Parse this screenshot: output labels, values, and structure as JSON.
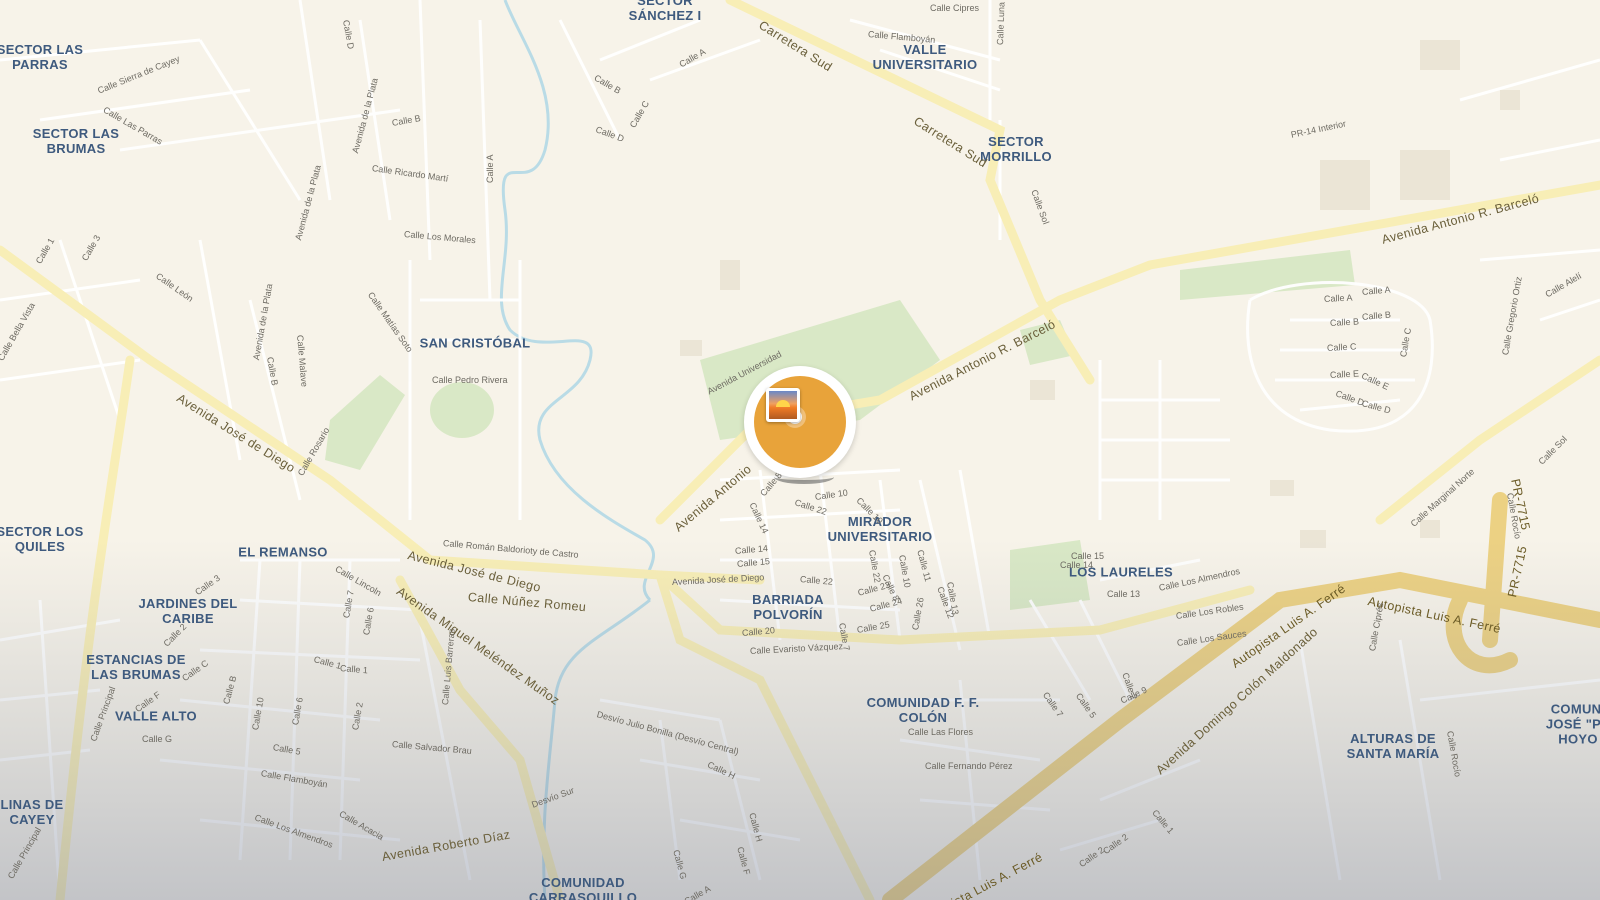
{
  "map": {
    "areas": [
      {
        "id": "sector-sanchez",
        "text": "SECTOR\nSÁNCHEZ I"
      },
      {
        "id": "valle-universitario",
        "text": "VALLE\nUNIVERSITARIO"
      },
      {
        "id": "sector-las-parras",
        "text": "SECTOR LAS\nPARRAS"
      },
      {
        "id": "sector-las-brumas",
        "text": "SECTOR LAS\nBRUMAS"
      },
      {
        "id": "sector-morrillo",
        "text": "SECTOR\nMORRILLO"
      },
      {
        "id": "san-cristobal",
        "text": "SAN CRISTÓBAL"
      },
      {
        "id": "sector-los-quiles",
        "text": "SECTOR LOS\nQUILES"
      },
      {
        "id": "el-remanso",
        "text": "EL REMANSO"
      },
      {
        "id": "mirador-universitario",
        "text": "MIRADOR\nUNIVERSITARIO"
      },
      {
        "id": "jardines-del-caribe",
        "text": "JARDINES DEL\nCARIBE"
      },
      {
        "id": "barriada-polvorin",
        "text": "BARRIADA\nPOLVORÍN"
      },
      {
        "id": "los-laureles",
        "text": "LOS LAURELES"
      },
      {
        "id": "estancias-las-brumas",
        "text": "ESTANCIAS DE\nLAS BRUMAS"
      },
      {
        "id": "valle-alto",
        "text": "VALLE ALTO"
      },
      {
        "id": "comunidad-colon",
        "text": "COMUNIDAD F. F.\nCOLÓN"
      },
      {
        "id": "alturas-santa-maria",
        "text": "ALTURAS DE\nSANTA MARÍA"
      },
      {
        "id": "comunidad-jose",
        "text": "COMUNI\nJOSÉ \"PE\nHOYO"
      },
      {
        "id": "lomas-de-cayey",
        "text": "LINAS DE\nCAYEY"
      },
      {
        "id": "comunidad-carrasquillo",
        "text": "COMUNIDAD\nCARRASQUILLO"
      }
    ],
    "major_roads": [
      {
        "id": "av-barcelo-east",
        "text": "Avenida Antonio R. Barceló"
      },
      {
        "id": "av-barcelo-mid",
        "text": "Avenida Antonio R. Barceló"
      },
      {
        "id": "av-antonio",
        "text": "Avenida Antonio"
      },
      {
        "id": "av-jose-diego-w",
        "text": "Avenida José de Diego"
      },
      {
        "id": "av-jose-diego-c",
        "text": "Avenida José de Diego"
      },
      {
        "id": "calle-nunez-romeu",
        "text": "Calle Núñez Romeu"
      },
      {
        "id": "carretera-sud-1",
        "text": "Carretera Sud"
      },
      {
        "id": "carretera-sud-2",
        "text": "Carretera Sud"
      },
      {
        "id": "av-melendez-munoz",
        "text": "Avenida Miguel Meléndez Muñoz"
      },
      {
        "id": "av-roberto-diaz",
        "text": "Avenida Roberto Díaz"
      },
      {
        "id": "av-domingo-colon",
        "text": "Avenida Domingo Colón Maldonado"
      }
    ],
    "highways": [
      {
        "id": "autopista-ferre-1",
        "text": "Autopista Luis A. Ferré"
      },
      {
        "id": "autopista-ferre-2",
        "text": "Autopista Luis A. Ferré"
      },
      {
        "id": "autopista-ferre-3",
        "text": "pista Luis A. Ferré"
      },
      {
        "id": "pr-7715-a",
        "text": "PR-7715"
      },
      {
        "id": "pr-7715-b",
        "text": "PR-7715"
      }
    ],
    "streets": [
      {
        "id": "s1",
        "text": "Calle Cipres"
      },
      {
        "id": "s2",
        "text": "Calle Flamboyán"
      },
      {
        "id": "s3",
        "text": "Calle Luna"
      },
      {
        "id": "s4",
        "text": "Calle A"
      },
      {
        "id": "s5",
        "text": "Calle B"
      },
      {
        "id": "s6",
        "text": "Calle C"
      },
      {
        "id": "s7",
        "text": "Calle D"
      },
      {
        "id": "s8",
        "text": "Calle D"
      },
      {
        "id": "s9",
        "text": "Calle Sierra de Cayey"
      },
      {
        "id": "s10",
        "text": "Calle Las Parras"
      },
      {
        "id": "s11",
        "text": "Avenida de la Plata"
      },
      {
        "id": "s12",
        "text": "Calle B"
      },
      {
        "id": "s13",
        "text": "Calle Ricardo Martí"
      },
      {
        "id": "s14",
        "text": "Calle A"
      },
      {
        "id": "s15",
        "text": "Calle Los Morales"
      },
      {
        "id": "s16",
        "text": "Avenida de la Plata"
      },
      {
        "id": "s17",
        "text": "PR-14 Interior"
      },
      {
        "id": "s18",
        "text": "Calle Sol"
      },
      {
        "id": "s19",
        "text": "Calle 1"
      },
      {
        "id": "s20",
        "text": "Calle 3"
      },
      {
        "id": "s21",
        "text": "Calle León"
      },
      {
        "id": "s22",
        "text": "Calle Matías Soto"
      },
      {
        "id": "s23",
        "text": "Avenida de la Plata"
      },
      {
        "id": "s24",
        "text": "Calle B"
      },
      {
        "id": "s25",
        "text": "Calle Malave"
      },
      {
        "id": "s26",
        "text": "Calle Pedro Rivera"
      },
      {
        "id": "s27",
        "text": "Calle Bella Vista"
      },
      {
        "id": "s28",
        "text": "Calle Rosario"
      },
      {
        "id": "s29",
        "text": "Avenida Universidad"
      },
      {
        "id": "s30",
        "text": "Calle A"
      },
      {
        "id": "s31",
        "text": "Calle B"
      },
      {
        "id": "s32",
        "text": "Calle C"
      },
      {
        "id": "s33",
        "text": "Calle E"
      },
      {
        "id": "s34",
        "text": "Calle D"
      },
      {
        "id": "s35",
        "text": "Calle B"
      },
      {
        "id": "s36",
        "text": "Calle A"
      },
      {
        "id": "s37",
        "text": "Calle E"
      },
      {
        "id": "s38",
        "text": "Calle D"
      },
      {
        "id": "s39",
        "text": "Calle C"
      },
      {
        "id": "s40",
        "text": "Calle Gregorio Ortiz"
      },
      {
        "id": "s41",
        "text": "Calle Alelí"
      },
      {
        "id": "s42",
        "text": "Calle Sol"
      },
      {
        "id": "s43",
        "text": "Calle Rocío"
      },
      {
        "id": "s44",
        "text": "Calle Marginal Norte"
      },
      {
        "id": "s45",
        "text": "Calle 8"
      },
      {
        "id": "s46",
        "text": "Calle 10"
      },
      {
        "id": "s47",
        "text": "Calle 10"
      },
      {
        "id": "s48",
        "text": "Calle 22"
      },
      {
        "id": "s49",
        "text": "Calle 14"
      },
      {
        "id": "s50",
        "text": "Calle 14"
      },
      {
        "id": "s51",
        "text": "Calle 15"
      },
      {
        "id": "s52",
        "text": "Calle 22"
      },
      {
        "id": "s53",
        "text": "Calle 20"
      },
      {
        "id": "s54",
        "text": "Calle 25"
      },
      {
        "id": "s55",
        "text": "Calle 24"
      },
      {
        "id": "s56",
        "text": "Calle 23"
      },
      {
        "id": "s57",
        "text": "Calle 22"
      },
      {
        "id": "s58",
        "text": "Calle 8"
      },
      {
        "id": "s59",
        "text": "Calle 10"
      },
      {
        "id": "s60",
        "text": "Calle 11"
      },
      {
        "id": "s61",
        "text": "Calle 12"
      },
      {
        "id": "s62",
        "text": "Calle 13"
      },
      {
        "id": "s63",
        "text": "Calle 26"
      },
      {
        "id": "s64",
        "text": "Calle 7"
      },
      {
        "id": "s65",
        "text": "Calle Evaristo Vázquez"
      },
      {
        "id": "s66",
        "text": "Avenida José de Diego"
      },
      {
        "id": "s67",
        "text": "Calle Román Baldorioty de Castro"
      },
      {
        "id": "s68",
        "text": "Calle Lincoln"
      },
      {
        "id": "s69",
        "text": "Calle 3"
      },
      {
        "id": "s70",
        "text": "Calle 2"
      },
      {
        "id": "s71",
        "text": "Calle 7"
      },
      {
        "id": "s72",
        "text": "Calle 6"
      },
      {
        "id": "s73",
        "text": "Calle 1"
      },
      {
        "id": "s74",
        "text": "Calle 1"
      },
      {
        "id": "s75",
        "text": "Calle Luis Barreras"
      },
      {
        "id": "s76",
        "text": "Calle C"
      },
      {
        "id": "s77",
        "text": "Calle B"
      },
      {
        "id": "s78",
        "text": "Calle F"
      },
      {
        "id": "s79",
        "text": "Calle Principal"
      },
      {
        "id": "s80",
        "text": "Calle G"
      },
      {
        "id": "s81",
        "text": "Calle 10"
      },
      {
        "id": "s82",
        "text": "Calle 6"
      },
      {
        "id": "s83",
        "text": "Calle 5"
      },
      {
        "id": "s84",
        "text": "Calle 2"
      },
      {
        "id": "s85",
        "text": "Calle Salvador Brau"
      },
      {
        "id": "s86",
        "text": "Calle Flamboyán"
      },
      {
        "id": "s87",
        "text": "Calle Los Almendros"
      },
      {
        "id": "s88",
        "text": "Calle Acacia"
      },
      {
        "id": "s89",
        "text": "Calle Principal"
      },
      {
        "id": "s90",
        "text": "Desvío Julio Bonilla (Desvío Central)"
      },
      {
        "id": "s91",
        "text": "Desvío Sur"
      },
      {
        "id": "s92",
        "text": "Calle H"
      },
      {
        "id": "s93",
        "text": "Calle H"
      },
      {
        "id": "s94",
        "text": "Calle F"
      },
      {
        "id": "s95",
        "text": "Calle G"
      },
      {
        "id": "s96",
        "text": "Calle A"
      },
      {
        "id": "s97",
        "text": "Calle Las Flores"
      },
      {
        "id": "s98",
        "text": "Calle Fernando Pérez"
      },
      {
        "id": "s99",
        "text": "Calle 15"
      },
      {
        "id": "s100",
        "text": "Calle 13"
      },
      {
        "id": "s101",
        "text": "Calle Los Almendros"
      },
      {
        "id": "s102",
        "text": "Calle Los Robles"
      },
      {
        "id": "s103",
        "text": "Calle Los Sauces"
      },
      {
        "id": "s104",
        "text": "Calle 2"
      },
      {
        "id": "s105",
        "text": "Calle 7"
      },
      {
        "id": "s106",
        "text": "Calle 5"
      },
      {
        "id": "s107",
        "text": "Calle 9"
      },
      {
        "id": "s108",
        "text": "Calle Ciprés"
      },
      {
        "id": "s109",
        "text": "Calle Rocío"
      },
      {
        "id": "s110",
        "text": "Calle 1"
      },
      {
        "id": "s111",
        "text": "Calle 2"
      },
      {
        "id": "s112",
        "text": "Calle 2"
      },
      {
        "id": "s113",
        "text": "Calle Las Flores"
      },
      {
        "id": "s114",
        "text": "Calle 15"
      },
      {
        "id": "s115",
        "text": "Calle 14"
      },
      {
        "id": "s116",
        "text": "Avenida José de Diego"
      }
    ],
    "marker": {
      "icon": "photo-icon",
      "color": "#e8a33a",
      "ring_color": "#ffffff"
    },
    "colors": {
      "land": "#f7f3e9",
      "park": "#d9e8c6",
      "water": "#b9dbe6",
      "road": "#ffffff",
      "major_road": "#f8eeb6",
      "highway": "#ecd183",
      "label": "#3e5a7e"
    }
  }
}
